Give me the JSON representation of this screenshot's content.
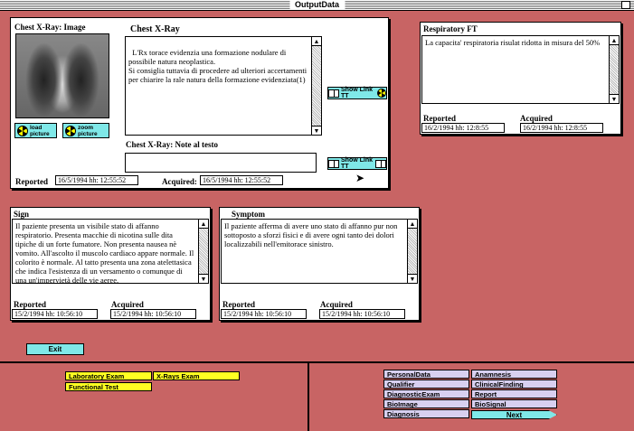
{
  "window": {
    "title": "OutputData"
  },
  "chest_xray": {
    "image_label": "Chest X-Ray: Image",
    "section_title": "Chest X-Ray",
    "report_text": "L'Rx torace evidenzia una formazione nodulare di possibile natura neoplastica.\nSi consiglia tuttavia di procedere ad ulteriori accertamenti per chiarire la rale natura della formazione evidenziata(1)",
    "notes_label": "Chest X-Ray: Note al testo",
    "notes_text": "",
    "load_picture": "load picture",
    "zoom_picture": "zoom picture",
    "show_link_label": "Show Link TT",
    "reported_label": "Reported",
    "reported_value": "16/5/1994 hh: 12:55:52",
    "acquired_label": "Acquired:",
    "acquired_value": "16/5/1994 hh: 12:55:52"
  },
  "respiratory": {
    "title": "Respiratory FT",
    "text": "La capacita' respiratoria risulat ridotta in misura del 50%",
    "reported_label": "Reported",
    "reported_value": "16/2/1994 hh: 12:8:55",
    "acquired_label": "Acquired",
    "acquired_value": "16/2/1994 hh: 12:8:55"
  },
  "sign": {
    "title": "Sign",
    "text": "Il paziente presenta un visibile stato di affanno respiratorio. Presenta macchie di nicotina sulle dita tipiche di un forte fumatore. Non presenta nausea nè vomito. All'ascolto il muscolo cardiaco appare normale. Il colorito è normale. Al tatto presenta una zona atelettasica che indica l'esistenza di un versamento o comunque di una un'impervietà delle vie aeree.",
    "reported_label": "Reported",
    "reported_value": "15/2/1994 hh: 10:56:10",
    "acquired_label": "Acquired",
    "acquired_value": "15/2/1994 hh: 10:56:10"
  },
  "symptom": {
    "title": "Symptom",
    "text": "Il paziente afferma di avere uno stato di affanno pur non sottoposto a sforzi fisici e di avere ogni tanto dei dolori localizzabili nell'emitorace sinistro.",
    "reported_label": "Reported",
    "reported_value": "15/2/1994 hh: 10:56:10",
    "acquired_label": "Acquired",
    "acquired_value": "15/2/1994 hh: 10:56:10"
  },
  "exit_label": "Exit",
  "left_nav": {
    "laboratory": "Laboratory Exam",
    "xrays": "X-Rays Exam",
    "functional": "Functional Test"
  },
  "right_nav": {
    "personal": "PersonalData",
    "anamnesis": "Anamnesis",
    "qualifier": "Qualifier",
    "clinical": "ClinicalFinding",
    "diagnostic": "DiagnosticExam",
    "report": "Report",
    "bioimage": "BioImage",
    "biosignal": "BioSignal",
    "diagnosis": "Diagnosis",
    "next": "Next"
  },
  "colors": {
    "background": "#c86464",
    "teal": "#7fe8e8",
    "yellow": "#ffff22",
    "lavender": "#d8d0f0"
  }
}
